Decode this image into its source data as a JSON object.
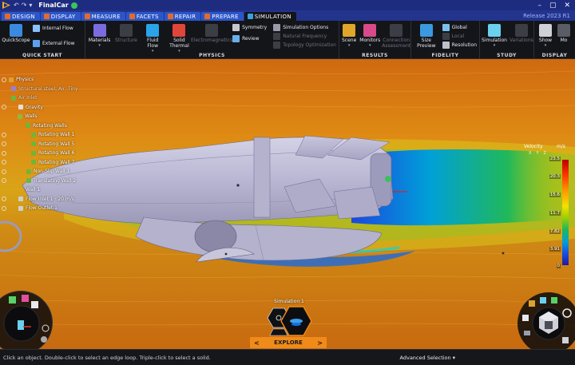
{
  "titlebar": {
    "app_title": "FinalCar",
    "quick_access": [
      "↶",
      "↷",
      "▾"
    ],
    "window_controls": [
      "–",
      "▢",
      "✕"
    ]
  },
  "tabs": [
    {
      "label": "DESIGN",
      "active": false
    },
    {
      "label": "DISPLAY",
      "active": false
    },
    {
      "label": "MEASURE",
      "active": false
    },
    {
      "label": "FACETS",
      "active": false
    },
    {
      "label": "REPAIR",
      "active": false
    },
    {
      "label": "PREPARE",
      "active": false
    },
    {
      "label": "SIMULATION",
      "active": true
    }
  ],
  "release": "Release 2023 R1",
  "ribbon": {
    "quickstart": {
      "label": "QUICK START",
      "quickscope": "QuickScope",
      "internal_flow": "Internal Flow",
      "external_flow": "External Flow"
    },
    "physics": {
      "label": "PHYSICS",
      "materials": "Materials",
      "structure": "Structure",
      "fluid_flow": "Fluid Flow",
      "solid_thermal": "Solid Thermal",
      "electromagnetics": "Electromagnetics",
      "symmetry": "Symmetry",
      "review": "Review",
      "simulation_options": "Simulation Options",
      "natural_frequency": "Natural Frequency",
      "topology_optimization": "Topology Optimization"
    },
    "results": {
      "label": "RESULTS",
      "scene": "Scene",
      "monitors": "Monitors",
      "connection_assessment": "Connection Assessment"
    },
    "fidelity": {
      "label": "FIDELITY",
      "size_preview": "Size Preview",
      "global": "Global",
      "local": "Local",
      "resolution": "Resolution"
    },
    "study": {
      "label": "STUDY",
      "simulation": "Simulation",
      "variations": "Variations"
    },
    "display": {
      "label": "DISPLAY",
      "show": "Show",
      "more": "Mo"
    }
  },
  "tree": [
    {
      "label": "Physics",
      "indent": 0,
      "dim": false
    },
    {
      "label": "Structural steel, Air, Tiny",
      "indent": 1,
      "dim": true
    },
    {
      "label": "Air Inlet",
      "indent": 1,
      "dim": true
    },
    {
      "label": "Gravity",
      "indent": 1,
      "dim": false
    },
    {
      "label": "Walls",
      "indent": 1,
      "dim": false
    },
    {
      "label": "Rotating Walls",
      "indent": 2,
      "dim": false
    },
    {
      "label": "Rotating Wall 1",
      "indent": 3,
      "dim": false
    },
    {
      "label": "Rotating Wall 5",
      "indent": 3,
      "dim": false
    },
    {
      "label": "Rotating Wall 6",
      "indent": 3,
      "dim": false
    },
    {
      "label": "Rotating Wall 7",
      "indent": 3,
      "dim": false
    },
    {
      "label": "Non-Slip Wall 1",
      "indent": 2,
      "dim": false
    },
    {
      "label": "Translating Wall 2",
      "indent": 2,
      "dim": false
    },
    {
      "label": "Wall 1",
      "indent": 2,
      "dim": false
    },
    {
      "label": "Flow Inlet 1 · 20 m/s",
      "indent": 1,
      "dim": false
    },
    {
      "label": "Flow Outlet 1",
      "indent": 1,
      "dim": false
    }
  ],
  "legend": {
    "title": "Velocity",
    "unit": "m/s",
    "axes": [
      "X",
      "Y",
      "Z"
    ],
    "ticks": [
      "23.5",
      "20.3",
      "15.6",
      "11.7",
      "7.82",
      "3.91",
      "0"
    ],
    "colors": {
      "max": "#b80000",
      "mid": "#f2e200",
      "low": "#00a0d8",
      "min": "#1f1aa0"
    }
  },
  "simulation": {
    "title": "Simulation 1",
    "explore": "EXPLORE",
    "prev": "<",
    "next": ">"
  },
  "status": {
    "hint": "Click an object. Double-click to select an edge loop. Triple-click to select a solid.",
    "selection_mode": "Advanced Selection"
  },
  "colors": {
    "titlebar": "#1e2c80",
    "tab": "#2c56c8",
    "ribbon": "#141519",
    "flow_bg": "#d77b12",
    "accent": "#f08a18"
  }
}
